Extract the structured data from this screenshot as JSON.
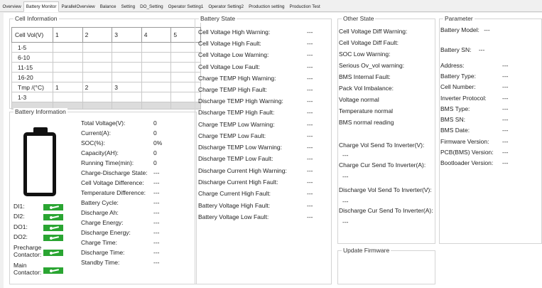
{
  "tabs": [
    "Overview",
    "Battery Monitor",
    "ParallelOverview",
    "Balance",
    "Setting",
    "DO_Setting",
    "Operator Setting1",
    "Operator Setting2",
    "Production setting",
    "Production Test"
  ],
  "active_tab": "Battery Monitor",
  "cell_information": {
    "title": "Cell Information",
    "header": [
      "Cell Vol(V)",
      "1",
      "2",
      "3",
      "4",
      "5"
    ],
    "rows": [
      [
        "1-5",
        "",
        "",
        "",
        "",
        ""
      ],
      [
        "6-10",
        "",
        "",
        "",
        "",
        ""
      ],
      [
        "11-15",
        "",
        "",
        "",
        "",
        ""
      ],
      [
        "16-20",
        "",
        "",
        "",
        "",
        ""
      ],
      [
        "Tmp /(°C)",
        "1",
        "2",
        "3",
        "",
        ""
      ],
      [
        "1-3",
        "",
        "",
        "",
        "",
        ""
      ]
    ]
  },
  "battery_information": {
    "title": "Battery Information",
    "fields": [
      {
        "label": "Total Voltage(V):",
        "value": "0"
      },
      {
        "label": "Current(A):",
        "value": "0"
      },
      {
        "label": "SOC(%):",
        "value": "0%"
      },
      {
        "label": "Capacity(AH):",
        "value": "0"
      },
      {
        "label": "Running Time(min):",
        "value": "0"
      },
      {
        "label": "Charge-Discharge State:",
        "value": "---"
      },
      {
        "label": "Cell Voltage Difference:",
        "value": "---"
      },
      {
        "label": "Temperature Difference:",
        "value": "---"
      },
      {
        "label": "Battery Cycle:",
        "value": "---"
      },
      {
        "label": "Discharge Ah:",
        "value": "---"
      },
      {
        "label": "Charge Energy:",
        "value": "---"
      },
      {
        "label": "Discharge Energy:",
        "value": "---"
      },
      {
        "label": "Charge Time:",
        "value": "---"
      },
      {
        "label": "Discharge Time:",
        "value": "---"
      },
      {
        "label": "Standby Time:",
        "value": "---"
      }
    ],
    "io": [
      {
        "label": "DI1:",
        "state": "on"
      },
      {
        "label": "DI2:",
        "state": "on"
      },
      {
        "label": "DO1:",
        "state": "on"
      },
      {
        "label": "DO2:",
        "state": "on"
      },
      {
        "label": "Precharge\nContactor:",
        "state": "on"
      },
      {
        "label": "Main\nContactor:",
        "state": "on"
      }
    ],
    "switch_color": "#2aa532"
  },
  "battery_state": {
    "title": "Battery State",
    "items": [
      {
        "label": "Cell Voltage High Warning:",
        "value": "---"
      },
      {
        "label": "Cell Voltage High Fault:",
        "value": "---"
      },
      {
        "label": "Cell Voltage Low Warning:",
        "value": "---"
      },
      {
        "label": "Cell Voltage Low Fault:",
        "value": "---"
      },
      {
        "label": "Charge TEMP High Warning:",
        "value": "---"
      },
      {
        "label": "Charge TEMP High Fault:",
        "value": "---"
      },
      {
        "label": "Discharge TEMP High Warning:",
        "value": "---"
      },
      {
        "label": "Discharge TEMP High Fault:",
        "value": "---"
      },
      {
        "label": "Charge TEMP Low Warning:",
        "value": "---"
      },
      {
        "label": "Charge TEMP Low Fault:",
        "value": "---"
      },
      {
        "label": "Discharge TEMP Low Warning:",
        "value": "---"
      },
      {
        "label": "Discharge TEMP Low Fault:",
        "value": "---"
      },
      {
        "label": "Discharge Current High Warning:",
        "value": "---"
      },
      {
        "label": "Discharge Current High Fault:",
        "value": "---"
      },
      {
        "label": "Charge Current High Fault:",
        "value": "---"
      },
      {
        "label": "Battery Voltage High Fault:",
        "value": "---"
      },
      {
        "label": "Battery Voltage Low Fault:",
        "value": "---"
      }
    ]
  },
  "other_state": {
    "title": "Other State",
    "items": [
      "Cell Voltage Diff Warning:",
      "Cell Voltage Diff Fault:",
      "SOC Low Warning:",
      "Serious Ov_vol warning:",
      "BMS Internal Fault:",
      "Pack Vol Imbalance:",
      "Voltage normal",
      "Temperature normal",
      "BMS normal reading"
    ],
    "send_items": [
      {
        "label": "Charge Vol Send To Inverter(V):",
        "value": "---"
      },
      {
        "label": "Charge Cur Send To Inverter(A):",
        "value": "---"
      },
      {
        "label": "Discharge Vol Send To Inverter(V):",
        "value": "---"
      },
      {
        "label": "Discharge Cur Send To Inverter(A):",
        "value": "---"
      }
    ]
  },
  "update_firmware": {
    "title": "Update Firmware"
  },
  "parameter": {
    "title": "Parameter",
    "battery_model": {
      "label": "Battery Model:",
      "value": "---"
    },
    "battery_sn": {
      "label": "Battery SN:",
      "value": "---"
    },
    "fields": [
      {
        "label": "Address:",
        "value": "---"
      },
      {
        "label": "Battery Type:",
        "value": "---"
      },
      {
        "label": "Cell Number:",
        "value": "---"
      },
      {
        "label": "Inverter Protocol:",
        "value": "---"
      },
      {
        "label": "BMS Type:",
        "value": "---"
      },
      {
        "label": "BMS SN:",
        "value": "---"
      },
      {
        "label": "BMS Date:",
        "value": "---"
      },
      {
        "label": "Firmware Version:",
        "value": "---"
      },
      {
        "label": "PCB(BMS) Version:",
        "value": "---"
      },
      {
        "label": "Bootloader Version:",
        "value": "---"
      }
    ]
  }
}
